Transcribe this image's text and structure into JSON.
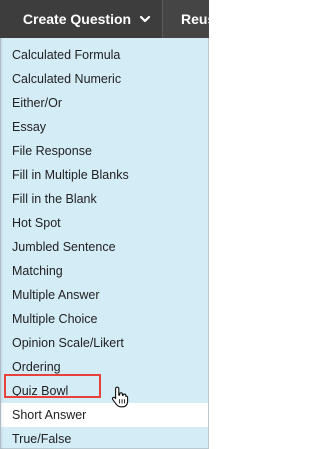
{
  "toolbar": {
    "create_label": "Create Question",
    "reuse_label": "Reuse"
  },
  "menu": {
    "items": [
      {
        "label": "Calculated Formula"
      },
      {
        "label": "Calculated Numeric"
      },
      {
        "label": "Either/Or"
      },
      {
        "label": "Essay"
      },
      {
        "label": "File Response"
      },
      {
        "label": "Fill in Multiple Blanks"
      },
      {
        "label": "Fill in the Blank"
      },
      {
        "label": "Hot Spot"
      },
      {
        "label": "Jumbled Sentence"
      },
      {
        "label": "Matching"
      },
      {
        "label": "Multiple Answer"
      },
      {
        "label": "Multiple Choice"
      },
      {
        "label": "Opinion Scale/Likert"
      },
      {
        "label": "Ordering"
      },
      {
        "label": "Quiz Bowl"
      },
      {
        "label": "Short Answer",
        "hovered": true
      },
      {
        "label": "True/False"
      }
    ]
  },
  "icons": {
    "dropdown": "chevron-down-icon",
    "pointer": "hand-pointer-cursor-icon"
  },
  "colors": {
    "toolbar_bg": "#3d3d3d",
    "menu_bg": "#d3ecf6",
    "hover_bg": "#ffffff",
    "highlight_border": "#e8413b"
  }
}
